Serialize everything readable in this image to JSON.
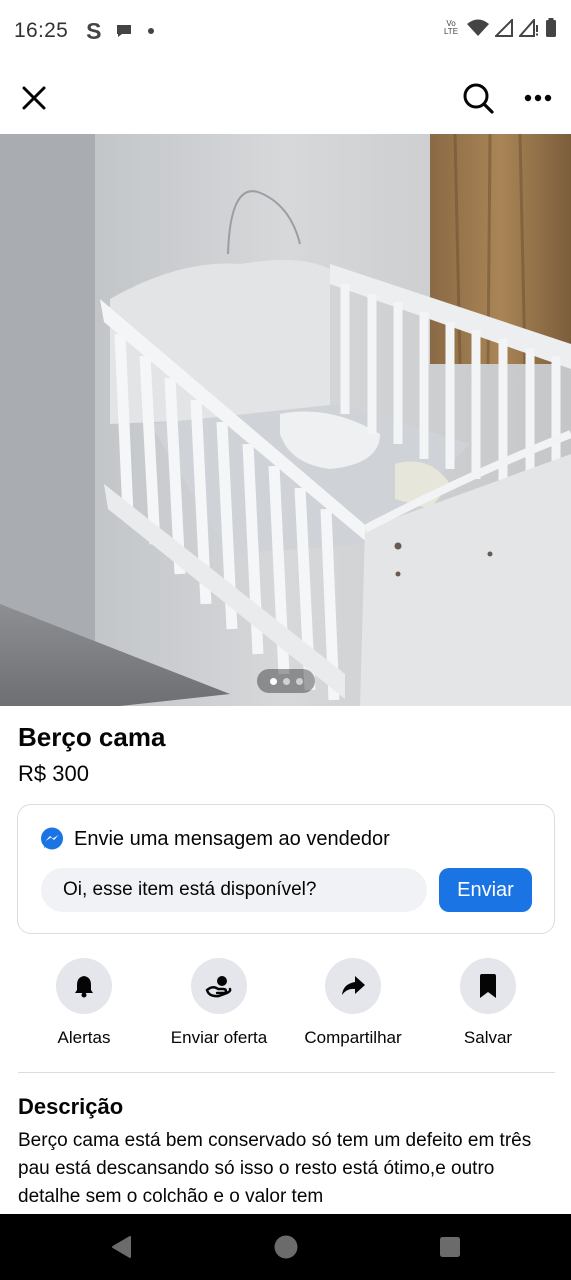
{
  "status_bar": {
    "time": "16:25",
    "app_letter": "S",
    "network": "Vo LTE",
    "icons": [
      "s-icon",
      "chat-bubble-icon",
      "dot-icon",
      "volte-icon",
      "wifi-icon",
      "signal-icon",
      "signal-alert-icon",
      "battery-icon"
    ]
  },
  "toolbar": {
    "icons": [
      "close-icon",
      "search-icon",
      "more-icon"
    ]
  },
  "listing": {
    "photo_pages": 3,
    "photo_active_page": 1,
    "title": "Berço cama",
    "price": "R$ 300"
  },
  "message": {
    "header": "Envie uma mensagem ao vendedor",
    "input_value": "Oi, esse item está disponível?",
    "send_label": "Enviar"
  },
  "actions": [
    {
      "label": "Alertas",
      "icon": "bell-icon"
    },
    {
      "label": "Enviar oferta",
      "icon": "offer-icon"
    },
    {
      "label": "Compartilhar",
      "icon": "share-icon"
    },
    {
      "label": "Salvar",
      "icon": "bookmark-icon"
    }
  ],
  "description": {
    "heading": "Descrição",
    "text": "Berço cama está bem conservado só tem um defeito em três pau está descansando só isso o resto está ótimo,e outro detalhe sem o colchão e o valor tem"
  },
  "nav": {
    "icons": [
      "back-icon",
      "home-icon",
      "recents-icon"
    ]
  },
  "colors": {
    "accent": "#1b74e4",
    "action_circle": "#e4e6eb",
    "input_bg": "#f0f2f5",
    "nav_bar": "#000000"
  }
}
